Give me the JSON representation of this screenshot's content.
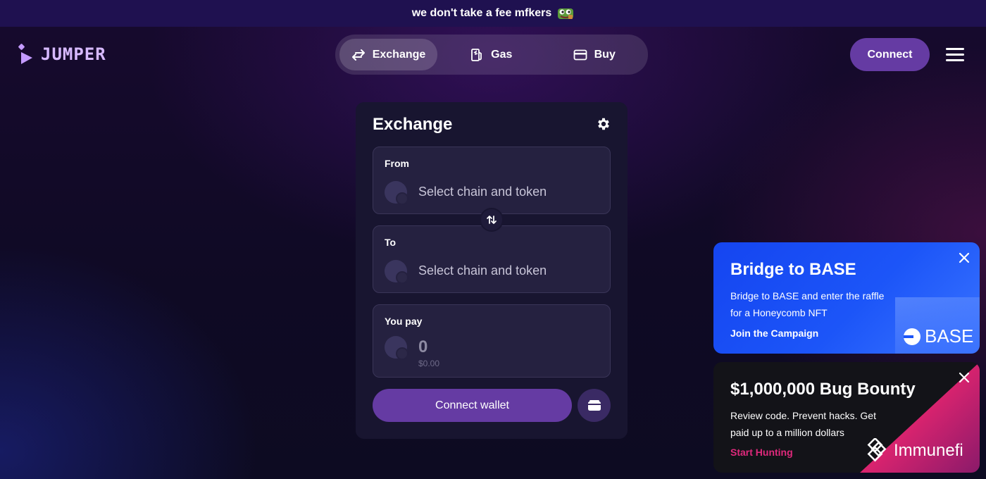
{
  "banner": {
    "text": "we don't take a fee mfkers",
    "icon": "frog-emoji-icon"
  },
  "logo": {
    "text": "JUMPER"
  },
  "nav": {
    "tabs": [
      {
        "label": "Exchange",
        "icon": "swap-arrows-icon",
        "active": true
      },
      {
        "label": "Gas",
        "icon": "gas-pump-icon",
        "active": false
      },
      {
        "label": "Buy",
        "icon": "credit-card-icon",
        "active": false
      }
    ],
    "connect_label": "Connect"
  },
  "widget": {
    "title": "Exchange",
    "from": {
      "label": "From",
      "placeholder": "Select chain and token"
    },
    "to": {
      "label": "To",
      "placeholder": "Select chain and token"
    },
    "pay": {
      "label": "You pay",
      "amount": "0",
      "usd": "$0.00"
    },
    "connect_wallet_label": "Connect wallet"
  },
  "promos": [
    {
      "title": "Bridge to BASE",
      "description": "Bridge to BASE and enter the raffle for a Honeycomb NFT",
      "link": "Join the Campaign",
      "brand": "BASE",
      "color": "#1c55f8"
    },
    {
      "title": "$1,000,000 Bug Bounty",
      "description": "Review code. Prevent hacks. Get paid up to a million dollars",
      "link": "Start Hunting",
      "brand": "Immunefi",
      "color": "#e0297c"
    }
  ],
  "colors": {
    "accent": "#653ba3",
    "card_bg": "#181530",
    "field_bg": "#252140"
  }
}
